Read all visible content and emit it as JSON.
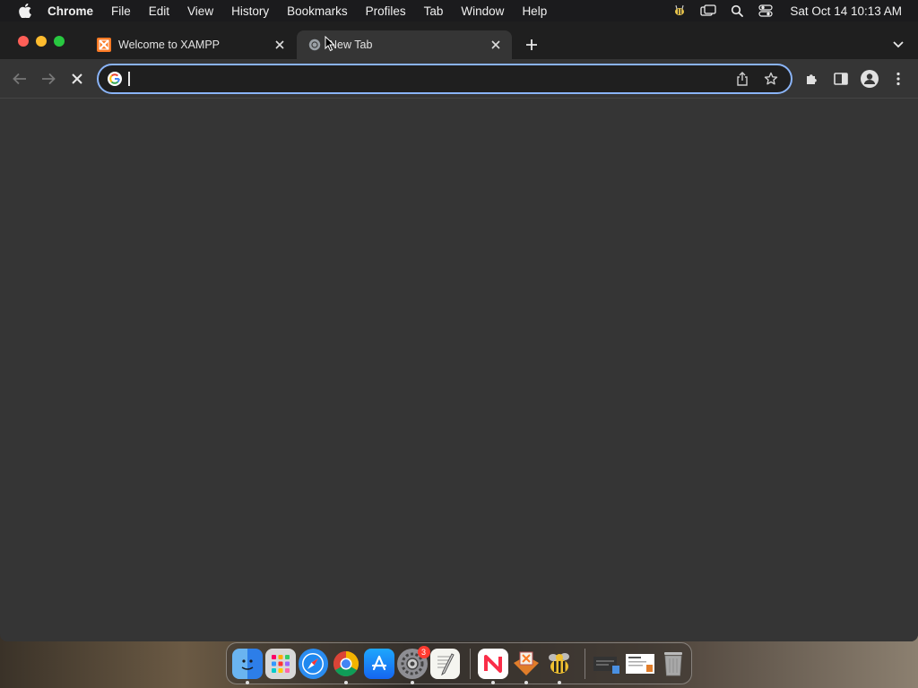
{
  "menubar": {
    "app_name": "Chrome",
    "items": [
      "File",
      "Edit",
      "View",
      "History",
      "Bookmarks",
      "Profiles",
      "Tab",
      "Window",
      "Help"
    ],
    "clock": "Sat Oct 14  10:13 AM"
  },
  "tabs": [
    {
      "title": "Welcome to XAMPP",
      "icon": "xampp-icon",
      "active": false
    },
    {
      "title": "New Tab",
      "icon": "chrome-icon",
      "active": true
    }
  ],
  "omnibox": {
    "value": "",
    "placeholder": ""
  },
  "dock": {
    "apps": [
      "finder",
      "launchpad",
      "safari",
      "chrome",
      "app-store",
      "system-settings",
      "textedit",
      "news",
      "xampp",
      "cyberduck"
    ],
    "system_settings_badge": "3"
  },
  "colors": {
    "accent": "#8ab4f8",
    "window_bg": "#353535",
    "tabstrip_bg": "#1f1f1f",
    "menubar_bg": "#1b1b1d"
  }
}
